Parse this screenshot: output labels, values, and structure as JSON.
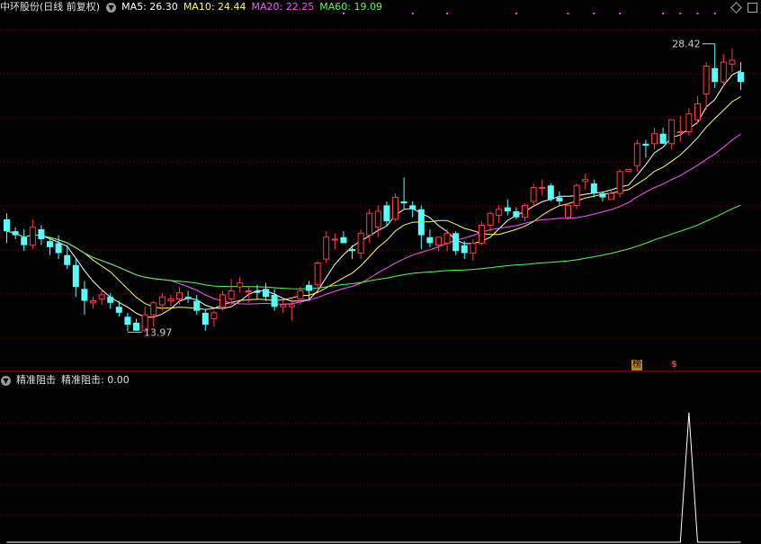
{
  "main_panel": {
    "stock_title": "中环股份(日线 前复权)",
    "indicators": [
      {
        "label": "MA5: 26.30",
        "color": "#ffffff"
      },
      {
        "label": "MA10: 24.44",
        "color": "#ffff54"
      },
      {
        "label": "MA20: 22.25",
        "color": "#ff54ff"
      },
      {
        "label": "MA60: 19.09",
        "color": "#54ff54"
      }
    ],
    "high_label": "28.42",
    "low_label": "13.97",
    "badges": [
      {
        "text": "榜",
        "bg": "#b8860b",
        "color": "#000000"
      },
      {
        "text": "$",
        "bg": "#000000",
        "color": "#ff3030"
      }
    ]
  },
  "sub_panel": {
    "indicator_name": "精准阻击",
    "value_label": "精准阻击: 0.00"
  },
  "colors": {
    "up": "#ff3c3c",
    "down": "#54ffff",
    "grid": "#800000",
    "divider": "#b00000",
    "signal_dot": "#ff40ff",
    "indicator_line": "#ffffff"
  },
  "chart_data": [
    {
      "type": "candlestick",
      "title": "中环股份(日线 前复权)",
      "ylim": [
        12.0,
        29.9
      ],
      "ohlc_columns": [
        "open",
        "high",
        "low",
        "close"
      ],
      "candles": [
        [
          19.6,
          19.9,
          18.4,
          19.0
        ],
        [
          19.0,
          19.2,
          18.6,
          18.8
        ],
        [
          18.7,
          19.1,
          18.0,
          18.3
        ],
        [
          18.3,
          19.6,
          18.1,
          19.2
        ],
        [
          19.1,
          19.3,
          18.3,
          18.6
        ],
        [
          18.5,
          18.7,
          17.8,
          18.2
        ],
        [
          18.4,
          18.8,
          17.6,
          17.9
        ],
        [
          17.8,
          18.3,
          17.1,
          17.3
        ],
        [
          17.3,
          17.6,
          15.7,
          16.2
        ],
        [
          16.1,
          16.5,
          14.8,
          15.5
        ],
        [
          15.4,
          15.7,
          15.1,
          15.5
        ],
        [
          15.6,
          16.1,
          15.3,
          15.8
        ],
        [
          15.7,
          15.9,
          15.1,
          15.4
        ],
        [
          15.2,
          15.5,
          14.7,
          14.9
        ],
        [
          14.7,
          14.9,
          13.97,
          14.3
        ],
        [
          14.4,
          14.6,
          14.0,
          14.0
        ],
        [
          14.0,
          15.2,
          13.9,
          14.8
        ],
        [
          14.8,
          15.5,
          14.2,
          15.4
        ],
        [
          15.3,
          15.9,
          15.0,
          15.7
        ],
        [
          15.5,
          15.8,
          15.2,
          15.6
        ],
        [
          15.6,
          16.2,
          15.3,
          15.9
        ],
        [
          15.7,
          16.0,
          15.4,
          15.6
        ],
        [
          15.5,
          15.8,
          14.8,
          15.0
        ],
        [
          14.9,
          15.1,
          14.0,
          14.3
        ],
        [
          14.6,
          15.0,
          14.2,
          14.9
        ],
        [
          15.2,
          16.0,
          15.0,
          15.8
        ],
        [
          15.6,
          16.6,
          15.3,
          16.0
        ],
        [
          16.2,
          16.7,
          15.9,
          16.4
        ],
        [
          16.0,
          16.2,
          15.4,
          16.0
        ],
        [
          16.0,
          16.3,
          15.6,
          15.9
        ],
        [
          16.1,
          16.4,
          15.5,
          15.7
        ],
        [
          15.8,
          16.1,
          15.0,
          15.2
        ],
        [
          15.2,
          15.6,
          14.9,
          15.3
        ],
        [
          15.2,
          15.6,
          14.5,
          15.3
        ],
        [
          15.6,
          16.2,
          15.3,
          16.0
        ],
        [
          16.3,
          16.5,
          15.5,
          16.0
        ],
        [
          16.3,
          17.5,
          16.1,
          17.4
        ],
        [
          17.6,
          19.0,
          17.4,
          18.7
        ],
        [
          18.6,
          18.9,
          18.1,
          18.6
        ],
        [
          18.7,
          19.0,
          18.4,
          18.4
        ],
        [
          18.1,
          18.3,
          17.6,
          18.0
        ],
        [
          17.9,
          19.1,
          17.6,
          18.9
        ],
        [
          18.8,
          20.1,
          18.4,
          19.9
        ],
        [
          19.2,
          20.3,
          18.7,
          20.0
        ],
        [
          20.3,
          20.5,
          19.3,
          19.5
        ],
        [
          19.6,
          20.9,
          19.5,
          20.7
        ],
        [
          20.5,
          21.7,
          20.1,
          20.4
        ],
        [
          20.3,
          20.5,
          19.7,
          20.1
        ],
        [
          20.1,
          20.3,
          18.1,
          18.8
        ],
        [
          18.7,
          19.1,
          18.2,
          18.4
        ],
        [
          18.3,
          18.7,
          18.0,
          18.7
        ],
        [
          18.4,
          19.1,
          18.0,
          18.9
        ],
        [
          18.9,
          19.0,
          17.8,
          18.0
        ],
        [
          18.3,
          18.5,
          17.6,
          17.9
        ],
        [
          17.9,
          18.6,
          17.5,
          18.4
        ],
        [
          18.4,
          19.5,
          18.3,
          19.3
        ],
        [
          19.3,
          20.0,
          19.0,
          19.9
        ],
        [
          19.8,
          20.3,
          19.4,
          20.1
        ],
        [
          20.2,
          20.6,
          19.8,
          20.0
        ],
        [
          20.0,
          20.2,
          19.6,
          19.7
        ],
        [
          19.7,
          20.4,
          19.5,
          20.3
        ],
        [
          20.5,
          21.4,
          20.3,
          21.2
        ],
        [
          21.2,
          21.6,
          20.8,
          21.2
        ],
        [
          21.3,
          21.4,
          20.5,
          20.6
        ],
        [
          20.7,
          21.0,
          20.3,
          20.5
        ],
        [
          19.7,
          20.4,
          19.6,
          20.3
        ],
        [
          20.3,
          21.4,
          20.1,
          21.3
        ],
        [
          21.5,
          21.9,
          21.1,
          21.6
        ],
        [
          21.4,
          21.6,
          20.7,
          20.9
        ],
        [
          20.9,
          21.0,
          20.5,
          20.7
        ],
        [
          20.6,
          21.1,
          20.6,
          20.9
        ],
        [
          20.9,
          22.1,
          20.7,
          22.0
        ],
        [
          22.0,
          22.1,
          22.0,
          22.1
        ],
        [
          22.3,
          23.6,
          22.0,
          23.4
        ],
        [
          23.4,
          23.6,
          22.7,
          23.3
        ],
        [
          23.4,
          24.2,
          23.1,
          23.9
        ],
        [
          23.9,
          24.2,
          23.4,
          23.4
        ],
        [
          23.4,
          24.6,
          23.1,
          24.6
        ],
        [
          24.0,
          24.8,
          23.5,
          24.0
        ],
        [
          24.0,
          25.2,
          23.8,
          24.9
        ],
        [
          24.6,
          25.8,
          24.4,
          25.4
        ],
        [
          25.9,
          27.5,
          25.1,
          27.3
        ],
        [
          27.2,
          28.42,
          26.2,
          26.5
        ],
        [
          26.5,
          27.9,
          26.3,
          27.5
        ],
        [
          27.4,
          28.2,
          27.0,
          27.6
        ],
        [
          27.0,
          27.5,
          26.1,
          26.5
        ]
      ],
      "moving_averages": [
        {
          "name": "MA5",
          "color": "#ffffff",
          "period": 5
        },
        {
          "name": "MA10",
          "color": "#ffff54",
          "period": 10
        },
        {
          "name": "MA20",
          "color": "#ff54ff",
          "period": 20
        },
        {
          "name": "MA60",
          "color": "#54ff54",
          "period": 60
        }
      ],
      "annotations": [
        {
          "text": "28.42",
          "candle_index": 82,
          "kind": "high"
        },
        {
          "text": "13.97",
          "candle_index": 14,
          "kind": "low"
        }
      ],
      "signal_dots_at": [
        39,
        47,
        51,
        59,
        65,
        68,
        71,
        76,
        78,
        80,
        82
      ]
    },
    {
      "type": "line",
      "title": "精准阻击",
      "ylim": [
        0,
        1.2
      ],
      "values_nonzero": [
        {
          "candle_index": 79,
          "value": 1.0
        }
      ],
      "default_value": 0.0
    }
  ]
}
